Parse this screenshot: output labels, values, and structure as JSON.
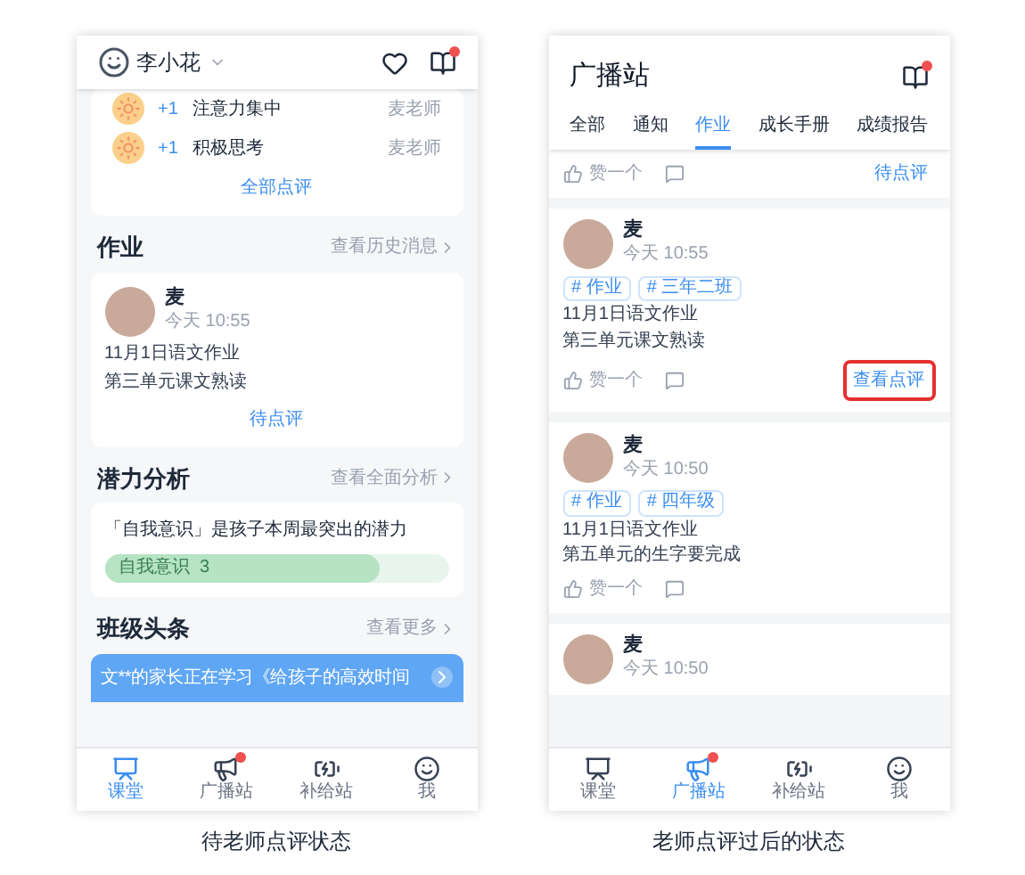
{
  "screens": [
    {
      "kind": "classroom",
      "user": {
        "name": "李小花"
      },
      "notification_dot": true,
      "comments": [
        {
          "points": "+1",
          "label": "注意力集中",
          "teacher": "麦老师"
        },
        {
          "points": "+1",
          "label": "积极思考",
          "teacher": "麦老师"
        }
      ],
      "all_comments": "全部点评",
      "sections": [
        {
          "kind": "homework",
          "title": "作业",
          "link": "查看历史消息",
          "author": "麦",
          "time": "今天 10:55",
          "lines": [
            "11月1日语文作业",
            "第三单元课文熟读"
          ],
          "action": "待点评"
        },
        {
          "kind": "potential",
          "title": "潜力分析",
          "link": "查看全面分析",
          "sentence": "「自我意识」是孩子本周最突出的潜力",
          "bar_label": "自我意识  3",
          "level": 0.8
        },
        {
          "kind": "news",
          "title": "班级头条",
          "link": "查看更多",
          "banner": "文**的家长正在学习《给孩子的高效时间"
        }
      ],
      "tabbar": [
        {
          "label": "课堂",
          "selected": true,
          "dot": false
        },
        {
          "label": "广播站",
          "selected": false,
          "dot": true
        },
        {
          "label": "补给站",
          "selected": false,
          "dot": false
        },
        {
          "label": "我",
          "selected": false,
          "dot": false
        }
      ],
      "caption": "待老师点评状态"
    },
    {
      "kind": "broadcast",
      "title": "广播站",
      "notification_dot": true,
      "tabs": [
        {
          "label": "全部",
          "selected": false
        },
        {
          "label": "通知",
          "selected": false
        },
        {
          "label": "作业",
          "selected": true
        },
        {
          "label": "成长手册",
          "selected": false
        },
        {
          "label": "成绩报告",
          "selected": false
        }
      ],
      "top_footer": {
        "like": "赞一个",
        "action": "待点评"
      },
      "posts": [
        {
          "author": "麦",
          "time": "今天 10:55",
          "tags": [
            "# 作业",
            "# 三年二班"
          ],
          "lines": [
            "11月1日语文作业",
            "第三单元课文熟读"
          ],
          "like": "赞一个",
          "action": "查看点评",
          "highlighted": true
        },
        {
          "author": "麦",
          "time": "今天 10:50",
          "tags": [
            "# 作业",
            "# 四年级"
          ],
          "lines": [
            "11月1日语文作业",
            "第五单元的生字要完成"
          ],
          "like": "赞一个"
        },
        {
          "author": "麦",
          "time": "今天 10:50"
        }
      ],
      "tabbar": [
        {
          "label": "课堂",
          "selected": false,
          "dot": false
        },
        {
          "label": "广播站",
          "selected": true,
          "dot": true
        },
        {
          "label": "补给站",
          "selected": false,
          "dot": false
        },
        {
          "label": "我",
          "selected": false,
          "dot": false
        }
      ],
      "caption": "老师点评过后的状态"
    }
  ]
}
